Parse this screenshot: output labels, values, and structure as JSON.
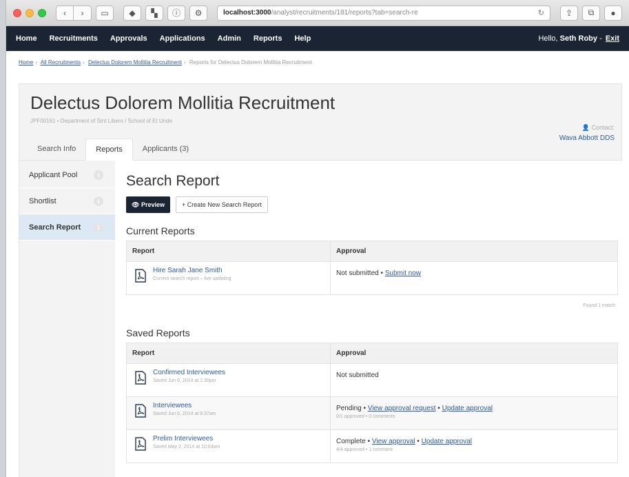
{
  "browser": {
    "url_host": "localhost:3000",
    "url_path": "/analyst/recruitments/181/reports?tab=search-re"
  },
  "nav": {
    "items": [
      "Home",
      "Recruitments",
      "Approvals",
      "Applications",
      "Admin",
      "Reports",
      "Help"
    ],
    "greeting": "Hello,",
    "user_name": "Seth Roby",
    "exit_label": "Exit"
  },
  "breadcrumb": {
    "links": [
      "Home",
      "All Recruitments",
      "Delectus Dolorem Mollitia Recruitment"
    ],
    "current": "Reports for Delectus Dolorem Mollitia Recruitment"
  },
  "header": {
    "title": "Delectus Dolorem Mollitia Recruitment",
    "subtitle": "JPF00161 • Department of Sint Libero / School of Et Unde",
    "contact_label": "Contact:",
    "contact_name": "Wava Abbott DDS",
    "tabs": [
      "Search Info",
      "Reports",
      "Applicants (3)"
    ]
  },
  "sidenav": {
    "items": [
      "Applicant Pool",
      "Shortlist",
      "Search Report"
    ],
    "info_glyph": "i"
  },
  "main": {
    "title": "Search Report",
    "preview_label": "Preview",
    "create_label": "Create New Search Report",
    "current_title": "Current Reports",
    "saved_title": "Saved Reports",
    "col_report": "Report",
    "col_approval": "Approval",
    "current_rows": [
      {
        "name": "Hire Sarah Jane Smith",
        "meta": "Current search report – live updating",
        "status": "Not submitted",
        "link1": "Submit now"
      }
    ],
    "found_text": "Found 1 match",
    "saved_rows": [
      {
        "name": "Confirmed Interviewees",
        "meta": "Saved Jun 6, 2014 at 1:30pm",
        "status": "Not submitted"
      },
      {
        "name": "Interviewees",
        "meta": "Saved Jun 6, 2014 at 9:37am",
        "status": "Pending",
        "link1": "View approval request",
        "link2": "Update approval",
        "approval_meta": "0/1 approved • 0 comments"
      },
      {
        "name": "Prelim Interviewees",
        "meta": "Saved May 2, 2014 at 10:04am",
        "status": "Complete",
        "link1": "View approval",
        "link2": "Update approval",
        "approval_meta": "4/4 approved • 1 comment"
      }
    ]
  }
}
